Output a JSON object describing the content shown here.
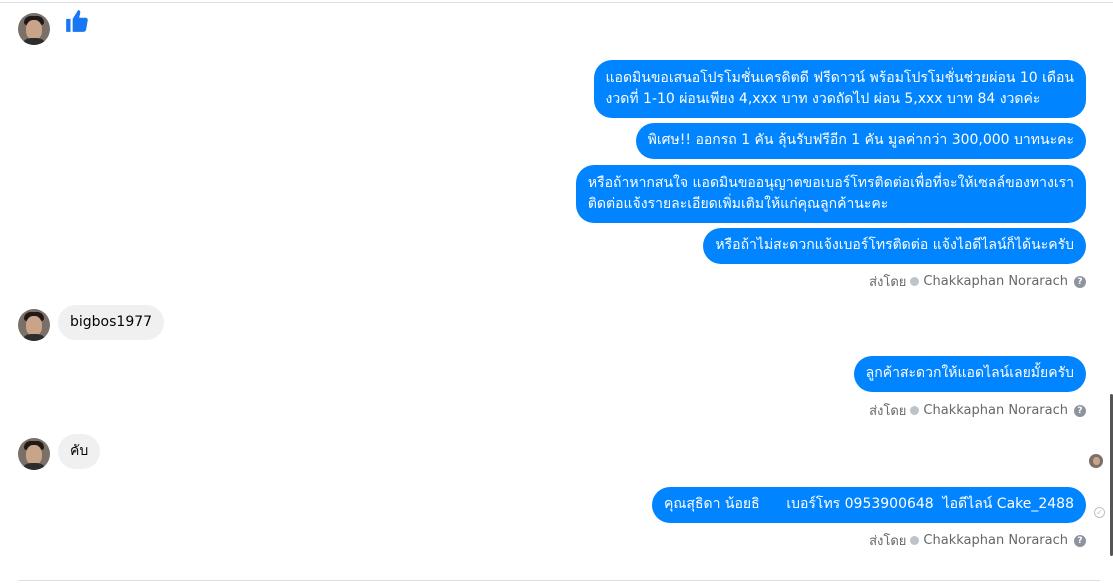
{
  "messages": {
    "out_block1": [
      {
        "line1": "แอดมินขอเสนอโปรโมชั่นเครดิตดี ฟรีดาวน์ พร้อมโปรโมชั่นช่วยผ่อน 10 เดือน",
        "line2": "งวดที่ 1-10 ผ่อนเพียง 4,xxx บาท งวดถัดไป ผ่อน 5,xxx บาท 84 งวดค่ะ"
      },
      {
        "line1": "พิเศษ!! ออกรถ 1 คัน ลุ้นรับฟรีอีก 1 คัน มูลค่ากว่า 300,000 บาทนะคะ"
      },
      {
        "line1": "หรือถ้าหากสนใจ แอดมินขออนุญาตขอเบอร์โทรติดต่อเพื่อที่จะให้เซลล์ของทางเรา",
        "line2": "ติดต่อแจ้งรายละเอียดเพิ่มเติมให้แก่คุณลูกค้านะคะ"
      },
      {
        "line1": "หรือถ้าไม่สะดวกแจ้งเบอร์โทรติดต่อ แจ้งไอดีไลน์ก็ได้นะครับ"
      }
    ],
    "in1": "bigbos1977",
    "out2": "ลูกค้าสะดวกให้แอดไลน์เลยมั้ยครับ",
    "in2": "คับ",
    "out3": "คุณสุธิดา น้อยธิ      เบอร์โทร 0953900648  ไอดีไลน์ Cake_2488"
  },
  "sent_by": {
    "label": "ส่งโดย",
    "name": "Chakkaphan Norarach",
    "help": "?"
  },
  "icons": {
    "like": "thumbs-up-icon",
    "seen": "seen-avatar-icon",
    "delivered": "check-circle-icon"
  },
  "colors": {
    "outgoing": "#0084ff",
    "incoming": "#f1f0f0",
    "like": "#1877f2"
  }
}
